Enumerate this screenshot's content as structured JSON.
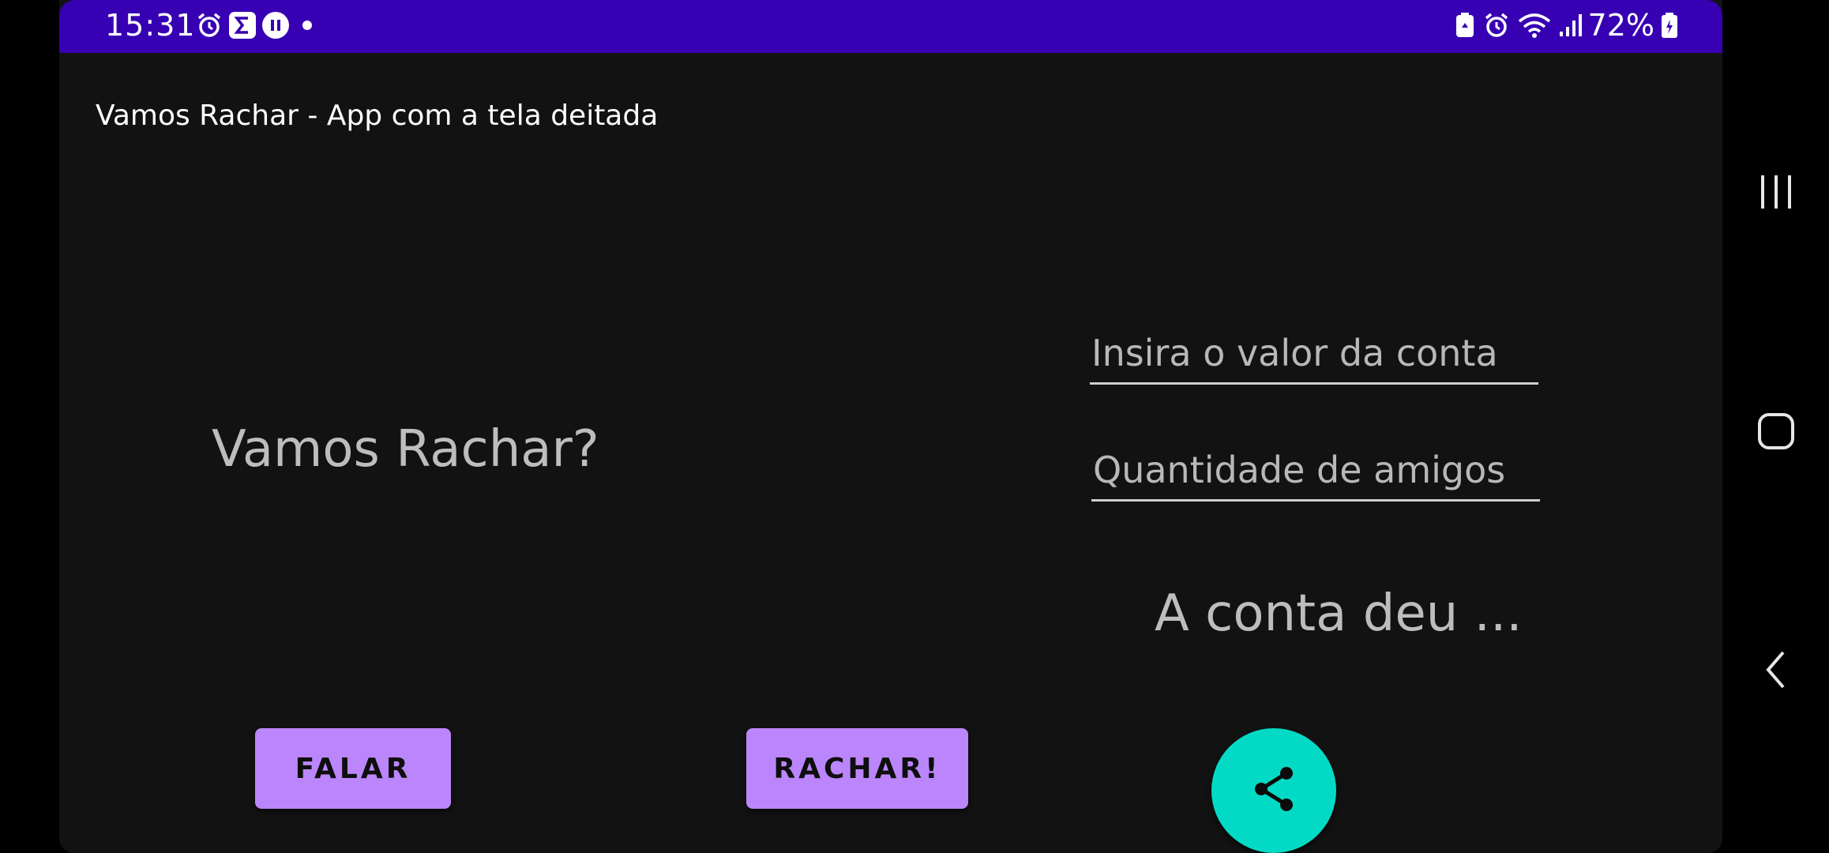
{
  "status_bar": {
    "time": "15:31",
    "battery": "72%",
    "icons_left": [
      "alarm-icon",
      "sigma-app-icon",
      "pause-icon",
      "dot-icon"
    ],
    "icons_right": [
      "battery-saver-icon",
      "alarm-icon",
      "wifi-icon",
      "signal-icon",
      "battery-icon"
    ]
  },
  "app": {
    "title": "Vamos Rachar - App com a tela deitada",
    "headline": "Vamos Rachar?",
    "bill_field": {
      "placeholder": "Insira o valor da conta",
      "value": ""
    },
    "friends_field": {
      "placeholder": "Quantidade de amigos",
      "value": ""
    },
    "result": "A conta deu ...",
    "speak_button": "FALAR",
    "split_button": "RACHAR!",
    "share_icon": "share-icon"
  },
  "colors": {
    "status_bar": "#3700b3",
    "background": "#121212",
    "button": "#bb86fc",
    "fab": "#03dac5"
  },
  "navbar": {
    "items": [
      "recent-apps-icon",
      "home-icon",
      "back-icon"
    ]
  }
}
